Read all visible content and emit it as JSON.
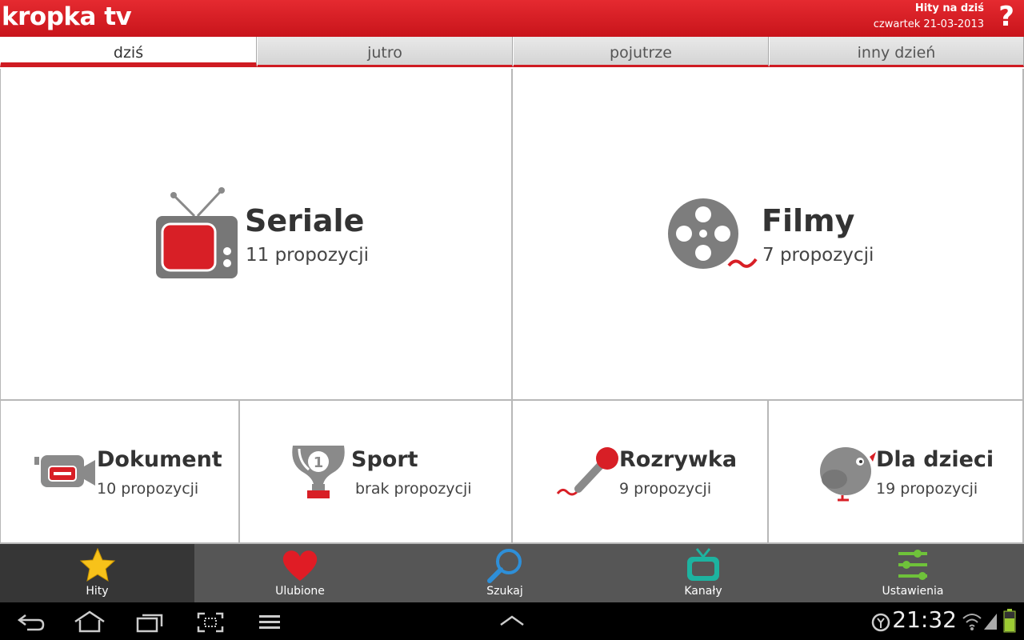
{
  "app": {
    "logo": "kropka tv",
    "header_title": "Hity na dziś",
    "header_date": "czwartek 21-03-2013",
    "help": "?"
  },
  "tabs": [
    {
      "label": "dziś",
      "active": true
    },
    {
      "label": "jutro",
      "active": false
    },
    {
      "label": "pojutrze",
      "active": false
    },
    {
      "label": "inny dzień",
      "active": false
    }
  ],
  "categories": {
    "seriale": {
      "title": "Seriale",
      "sub": "11 propozycji",
      "icon": "tv-icon"
    },
    "filmy": {
      "title": "Filmy",
      "sub": "7 propozycji",
      "icon": "film-reel-icon"
    },
    "dokument": {
      "title": "Dokument",
      "sub": "10 propozycji",
      "icon": "camera-icon"
    },
    "sport": {
      "title": "Sport",
      "sub": "brak propozycji",
      "icon": "trophy-icon"
    },
    "rozrywka": {
      "title": "Rozrywka",
      "sub": "9 propozycji",
      "icon": "microphone-icon"
    },
    "dzieci": {
      "title": "Dla dzieci",
      "sub": "19 propozycji",
      "icon": "bird-icon"
    }
  },
  "bottom_nav": [
    {
      "label": "Hity",
      "icon": "star-icon",
      "active": true
    },
    {
      "label": "Ulubione",
      "icon": "heart-icon",
      "active": false
    },
    {
      "label": "Szukaj",
      "icon": "search-icon",
      "active": false
    },
    {
      "label": "Kanały",
      "icon": "tv-icon",
      "active": false
    },
    {
      "label": "Ustawienia",
      "icon": "settings-sliders-icon",
      "active": false
    }
  ],
  "system_bar": {
    "time": "21:32"
  },
  "colors": {
    "brand_red": "#cf1b22",
    "nav_bg": "#565656",
    "nav_active": "#363636"
  }
}
